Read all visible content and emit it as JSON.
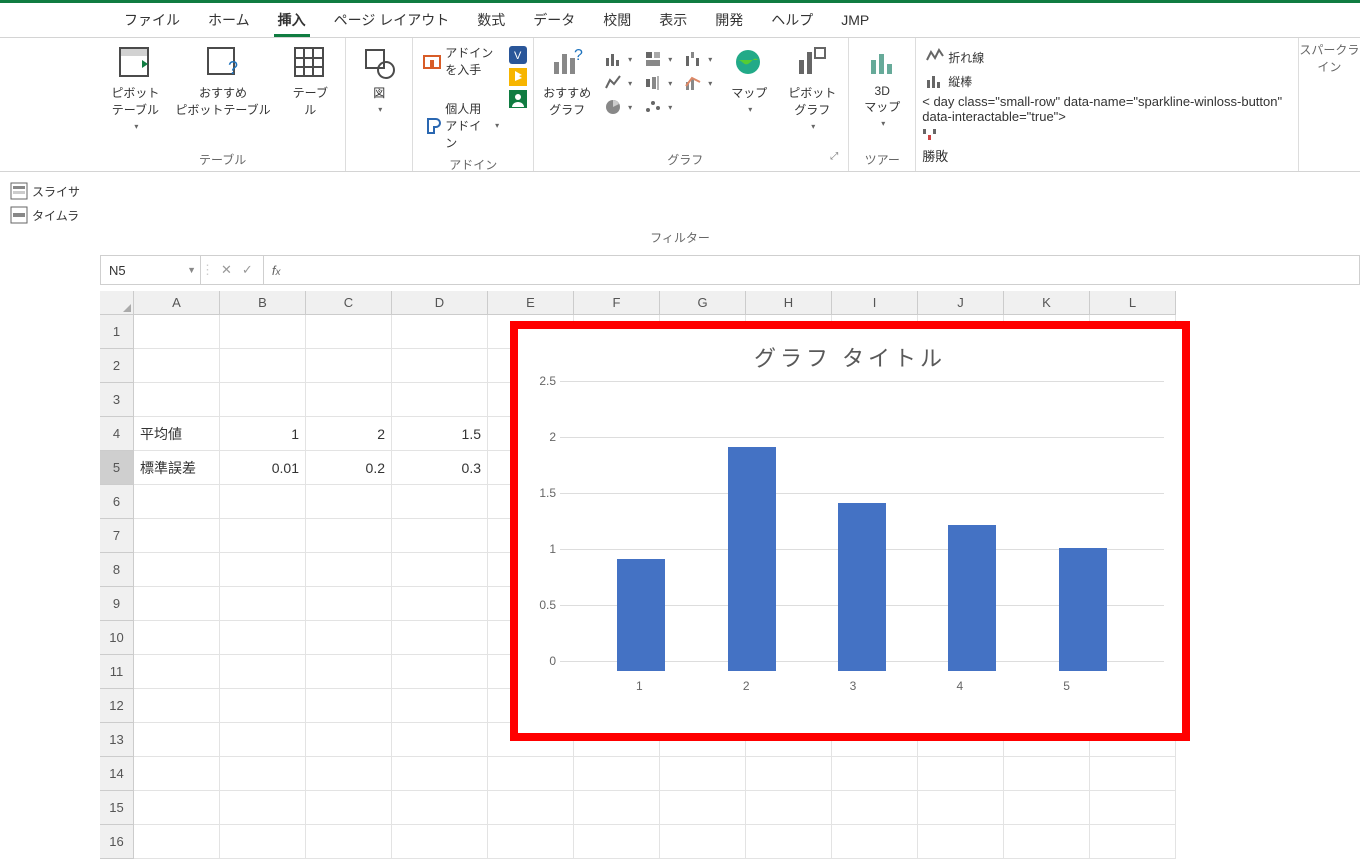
{
  "menu": {
    "file": "ファイル",
    "home": "ホーム",
    "insert": "挿入",
    "page_layout": "ページ レイアウト",
    "formulas": "数式",
    "data": "データ",
    "review": "校閲",
    "view": "表示",
    "developer": "開発",
    "help": "ヘルプ",
    "jmp": "JMP"
  },
  "ribbon": {
    "tables": {
      "pivot_table": "ピボット\nテーブル",
      "recommended_pivot": "おすすめ\nピボットテーブル",
      "table": "テーブル",
      "group": "テーブル"
    },
    "illustrations": {
      "figure": "図"
    },
    "addins": {
      "get_addins": "アドインを入手",
      "my_addins": "個人用アドイン",
      "group": "アドイン"
    },
    "charts": {
      "recommended": "おすすめ\nグラフ",
      "maps": "マップ",
      "pivot_chart": "ピボットグラフ",
      "group": "グラフ"
    },
    "tours": {
      "map3d": "3D\nマップ",
      "group": "ツアー"
    },
    "sparklines": {
      "line": "折れ線",
      "column": "縦棒",
      "winloss": "勝敗",
      "group": "スパークライン"
    },
    "filters": {
      "slicer": "スライサ",
      "timeline": "タイムラ",
      "group": "フィルター"
    }
  },
  "name_box": "N5",
  "columns": [
    "A",
    "B",
    "C",
    "D",
    "E",
    "F",
    "G",
    "H",
    "I",
    "J",
    "K",
    "L"
  ],
  "rows": [
    "1",
    "2",
    "3",
    "4",
    "5",
    "6",
    "7",
    "8",
    "9",
    "10",
    "11",
    "12",
    "13",
    "14",
    "15",
    "16"
  ],
  "cells": {
    "A4": "平均値",
    "B4": "1",
    "C4": "2",
    "D4": "1.5",
    "A5": "標準誤差",
    "B5": "0.01",
    "C5": "0.2",
    "D5": "0.3"
  },
  "chart_data": {
    "type": "bar",
    "title": "グラフ タイトル",
    "categories": [
      "1",
      "2",
      "3",
      "4",
      "5"
    ],
    "values": [
      1,
      2,
      1.5,
      1.3,
      1.1
    ],
    "ylim": [
      0,
      2.5
    ],
    "yticks": [
      0,
      0.5,
      1,
      1.5,
      2,
      2.5
    ]
  }
}
